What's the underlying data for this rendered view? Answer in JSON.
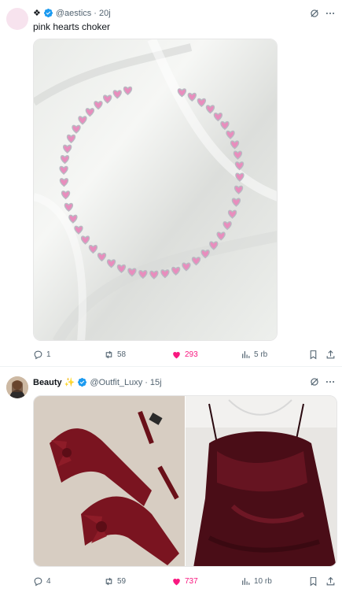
{
  "tweets": [
    {
      "display_name": "❖",
      "handle": "@aestics",
      "time": "20j",
      "text": "pink hearts choker",
      "replies": "1",
      "retweets": "58",
      "likes": "293",
      "views": "5 rb"
    },
    {
      "display_name": "Beauty ✨",
      "handle": "@Outfit_Luxy",
      "time": "15j",
      "text": "",
      "replies": "4",
      "retweets": "59",
      "likes": "737",
      "views": "10 rb"
    }
  ],
  "separator": "·",
  "colors": {
    "verified": "#1d9bf0",
    "like_active": "#f91880",
    "secondary_text": "#536471"
  },
  "icons": [
    "verified-badge-icon",
    "grok-icon",
    "more-icon",
    "reply-icon",
    "retweet-icon",
    "heart-icon",
    "views-icon",
    "bookmark-icon",
    "share-icon"
  ]
}
